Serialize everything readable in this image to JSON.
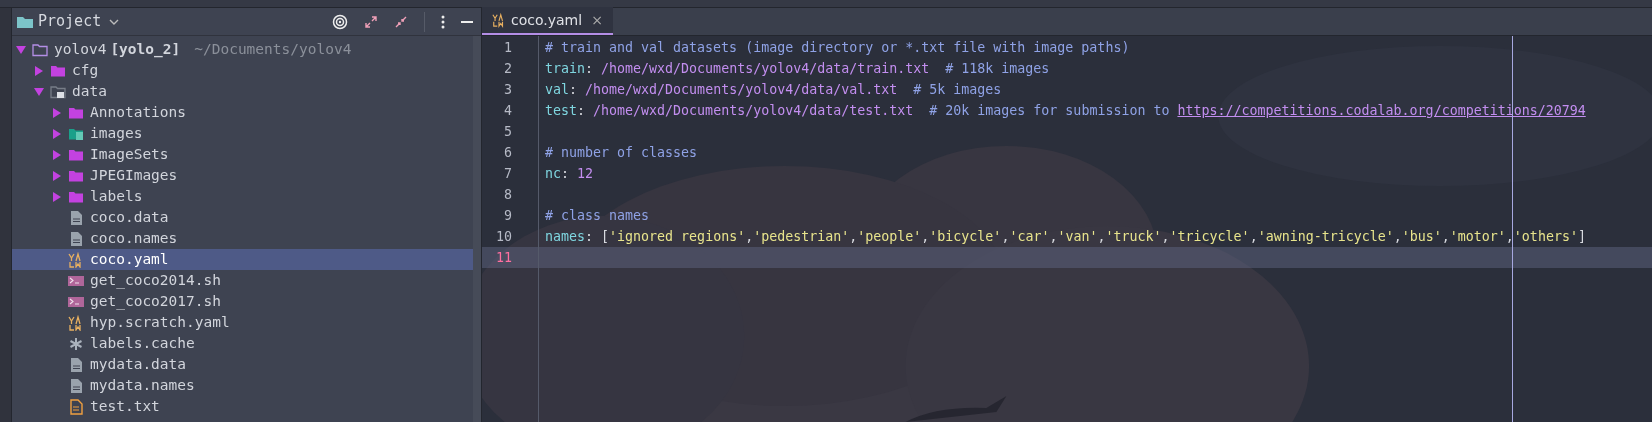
{
  "project_panel": {
    "title": "Project",
    "tree": [
      {
        "label": "yolov4",
        "module": "[yolo_2]",
        "path": "~/Documents/yolov4",
        "kind": "root_folder",
        "expanded": true,
        "selected": false,
        "children": [
          {
            "label": "cfg",
            "kind": "folder",
            "expanded": false,
            "selected": false
          },
          {
            "label": "data",
            "kind": "locked_folder",
            "expanded": true,
            "selected": false,
            "children": [
              {
                "label": "Annotations",
                "kind": "folder",
                "expanded": false,
                "selected": false
              },
              {
                "label": "images",
                "kind": "resource_folder",
                "expanded": false,
                "selected": false
              },
              {
                "label": "ImageSets",
                "kind": "folder",
                "expanded": false,
                "selected": false
              },
              {
                "label": "JPEGImages",
                "kind": "folder",
                "expanded": false,
                "selected": false
              },
              {
                "label": "labels",
                "kind": "folder",
                "expanded": false,
                "selected": false
              },
              {
                "label": "coco.data",
                "kind": "text",
                "selected": false
              },
              {
                "label": "coco.names",
                "kind": "text",
                "selected": false
              },
              {
                "label": "coco.yaml",
                "kind": "yaml",
                "selected": true
              },
              {
                "label": "get_coco2014.sh",
                "kind": "shell",
                "selected": false
              },
              {
                "label": "get_coco2017.sh",
                "kind": "shell",
                "selected": false
              },
              {
                "label": "hyp.scratch.yaml",
                "kind": "yaml",
                "selected": false
              },
              {
                "label": "labels.cache",
                "kind": "cache",
                "selected": false
              },
              {
                "label": "mydata.data",
                "kind": "text",
                "selected": false
              },
              {
                "label": "mydata.names",
                "kind": "text",
                "selected": false
              },
              {
                "label": "test.txt",
                "kind": "txt",
                "selected": false
              }
            ]
          }
        ]
      }
    ]
  },
  "editor": {
    "tabs": [
      {
        "label": "coco.yaml",
        "close": "×",
        "selected": true
      }
    ],
    "lines": [
      {
        "number": "1",
        "current": false,
        "tokens": [
          {
            "kind": "comment",
            "text": "# train and val datasets (image directory or *.txt file with image paths)"
          }
        ]
      },
      {
        "number": "2",
        "current": false,
        "tokens": [
          {
            "kind": "key",
            "text": "train"
          },
          {
            "kind": "punct",
            "text": ": "
          },
          {
            "kind": "value",
            "text": "/home/wxd/Documents/yolov4/data/train.txt"
          },
          {
            "kind": "comment",
            "text": "  # 118k images"
          }
        ]
      },
      {
        "number": "3",
        "current": false,
        "tokens": [
          {
            "kind": "key",
            "text": "val"
          },
          {
            "kind": "punct",
            "text": ": "
          },
          {
            "kind": "value",
            "text": "/home/wxd/Documents/yolov4/data/val.txt"
          },
          {
            "kind": "comment",
            "text": "  # 5k images"
          }
        ]
      },
      {
        "number": "4",
        "current": false,
        "tokens": [
          {
            "kind": "key",
            "text": "test"
          },
          {
            "kind": "punct",
            "text": ": "
          },
          {
            "kind": "value",
            "text": "/home/wxd/Documents/yolov4/data/test.txt"
          },
          {
            "kind": "comment",
            "text": "  # 20k images for submission to "
          },
          {
            "kind": "link",
            "text": "https://competitions.codalab.org/competitions/20794"
          }
        ]
      },
      {
        "number": "5",
        "current": false
      },
      {
        "number": "6",
        "current": false,
        "tokens": [
          {
            "kind": "comment",
            "text": "# number of classes"
          }
        ]
      },
      {
        "number": "7",
        "current": false,
        "tokens": [
          {
            "kind": "key",
            "text": "nc"
          },
          {
            "kind": "punct",
            "text": ": "
          },
          {
            "kind": "value",
            "text": "12"
          }
        ]
      },
      {
        "number": "8",
        "current": false
      },
      {
        "number": "9",
        "current": false,
        "tokens": [
          {
            "kind": "comment",
            "text": "# class names"
          }
        ]
      },
      {
        "number": "10",
        "current": false,
        "tokens": [
          {
            "kind": "key",
            "text": "names"
          },
          {
            "kind": "punct",
            "text": ": ["
          },
          {
            "kind": "string",
            "text": "'ignored regions'"
          },
          {
            "kind": "punct",
            "text": ","
          },
          {
            "kind": "string",
            "text": "'pedestrian'"
          },
          {
            "kind": "punct",
            "text": ","
          },
          {
            "kind": "string",
            "text": "'people'"
          },
          {
            "kind": "punct",
            "text": ","
          },
          {
            "kind": "string",
            "text": "'bicycle'"
          },
          {
            "kind": "punct",
            "text": ","
          },
          {
            "kind": "string",
            "text": "'car'"
          },
          {
            "kind": "punct",
            "text": ","
          },
          {
            "kind": "string",
            "text": "'van'"
          },
          {
            "kind": "punct",
            "text": ","
          },
          {
            "kind": "string",
            "text": "'truck'"
          },
          {
            "kind": "punct",
            "text": ","
          },
          {
            "kind": "string",
            "text": "'tricycle'"
          },
          {
            "kind": "punct",
            "text": ","
          },
          {
            "kind": "string",
            "text": "'awning-tricycle'"
          },
          {
            "kind": "punct",
            "text": ","
          },
          {
            "kind": "string",
            "text": "'bus'"
          },
          {
            "kind": "punct",
            "text": ","
          },
          {
            "kind": "string",
            "text": "'motor'"
          },
          {
            "kind": "punct",
            "text": ","
          },
          {
            "kind": "string",
            "text": "'others'"
          },
          {
            "kind": "punct",
            "text": "]"
          }
        ]
      },
      {
        "number": "11",
        "current": true
      }
    ]
  }
}
